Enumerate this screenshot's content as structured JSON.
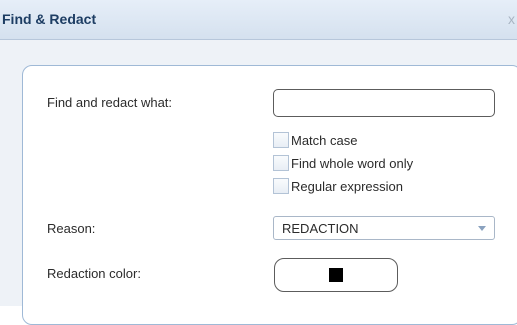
{
  "dialog": {
    "title": "Find & Redact",
    "close_glyph": "x"
  },
  "form": {
    "find_label": "Find and redact what:",
    "find_value": "",
    "options": [
      {
        "label": "Match case",
        "checked": false
      },
      {
        "label": "Find whole word only",
        "checked": false
      },
      {
        "label": "Regular expression",
        "checked": false
      }
    ],
    "reason_label": "Reason:",
    "reason_value": "REDACTION",
    "color_label": "Redaction color:",
    "redaction_color": "#000000"
  },
  "colors": {
    "title_text": "#1d3d63",
    "panel_border": "#9fb9d6",
    "chevron": "#8aa2bf"
  },
  "icons": {
    "close": "close-icon",
    "dropdown": "chevron-down-icon"
  }
}
